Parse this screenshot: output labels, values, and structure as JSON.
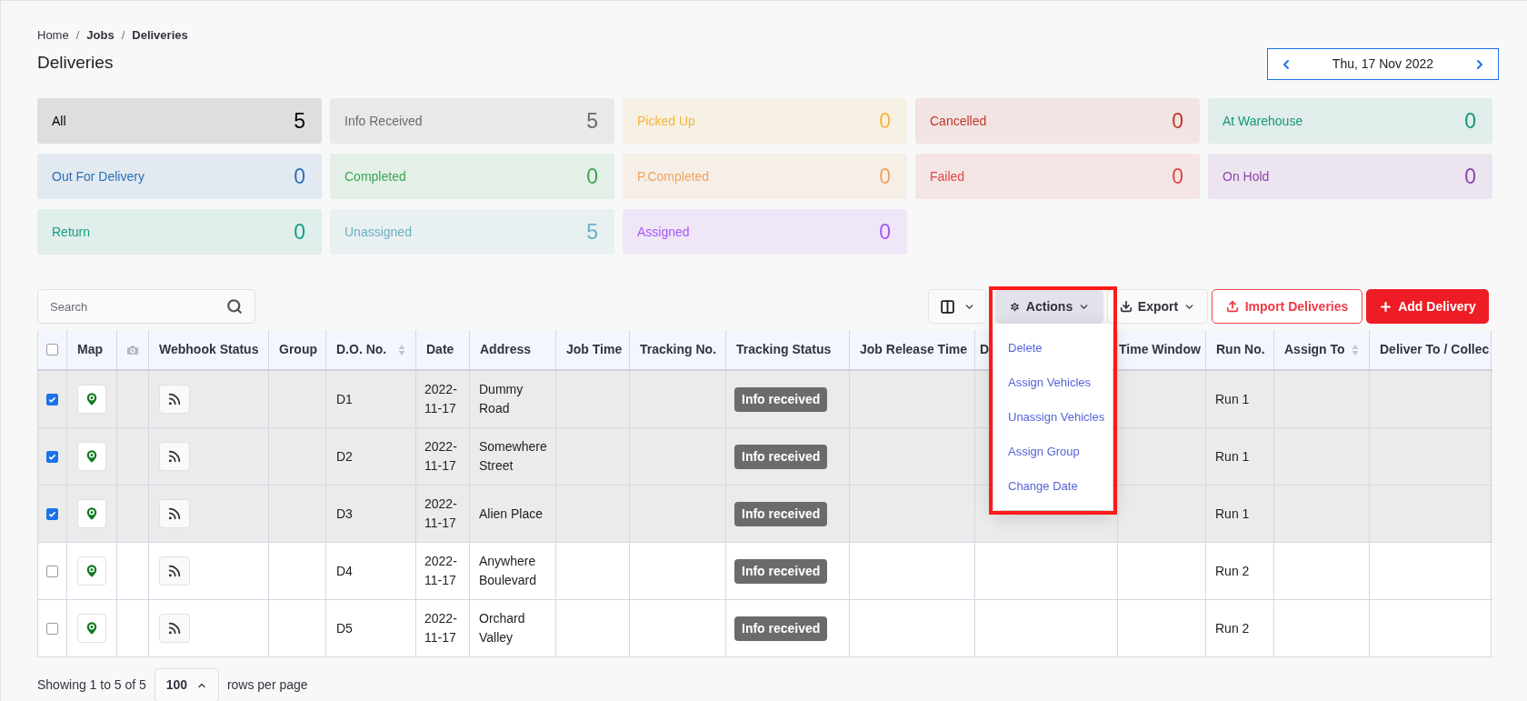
{
  "breadcrumb": {
    "separator": "/",
    "items": [
      {
        "label": "Home",
        "bold": false
      },
      {
        "label": "Jobs",
        "bold": true
      },
      {
        "label": "Deliveries",
        "bold": true
      }
    ]
  },
  "title": "Deliveries",
  "date_picker": {
    "value": "Thu, 17 Nov 2022"
  },
  "status_cards": [
    {
      "label": "All",
      "count": "5",
      "color": "#000000"
    },
    {
      "label": "Info Received",
      "count": "5",
      "color": "#6b6b6b"
    },
    {
      "label": "Picked Up",
      "count": "0",
      "color": "#f5b53b"
    },
    {
      "label": "Cancelled",
      "count": "0",
      "color": "#c0392b"
    },
    {
      "label": "At Warehouse",
      "count": "0",
      "color": "#14967a"
    },
    {
      "label": "Out For Delivery",
      "count": "0",
      "color": "#2b6fb5"
    },
    {
      "label": "Completed",
      "count": "0",
      "color": "#3aa655"
    },
    {
      "label": "P.Completed",
      "count": "0",
      "color": "#f0a35e"
    },
    {
      "label": "Failed",
      "count": "0",
      "color": "#e04848"
    },
    {
      "label": "On Hold",
      "count": "0",
      "color": "#8e44ad"
    },
    {
      "label": "Return",
      "count": "0",
      "color": "#16a085"
    },
    {
      "label": "Unassigned",
      "count": "5",
      "color": "#6bb0c6"
    },
    {
      "label": "Assigned",
      "count": "0",
      "color": "#a855f7"
    }
  ],
  "search": {
    "placeholder": "Search"
  },
  "toolbar": {
    "actions": {
      "label": "Actions",
      "expanded": true,
      "items": [
        "Delete",
        "Assign Vehicles",
        "Unassign Vehicles",
        "Assign Group",
        "Change Date"
      ]
    },
    "export": {
      "label": "Export"
    },
    "import": {
      "label": "Import Deliveries"
    },
    "add": {
      "label": "Add Delivery"
    }
  },
  "table": {
    "columns": [
      {
        "kind": "checkbox",
        "checked": false
      },
      {
        "kind": "text",
        "label": "Map"
      },
      {
        "kind": "icon"
      },
      {
        "kind": "text",
        "label": "Webhook Status"
      },
      {
        "kind": "text",
        "label": "Group"
      },
      {
        "kind": "text",
        "label": "D.O. No.",
        "sortable": true
      },
      {
        "kind": "text",
        "label": "Date"
      },
      {
        "kind": "text",
        "label": "Address"
      },
      {
        "kind": "text",
        "label": "Job Time"
      },
      {
        "kind": "text",
        "label": "Tracking No."
      },
      {
        "kind": "text",
        "label": "Tracking Status"
      },
      {
        "kind": "text",
        "label": "Job Release Time"
      },
      {
        "kind": "text",
        "label": "D"
      },
      {
        "kind": "text",
        "label": "Time Window"
      },
      {
        "kind": "text",
        "label": "Run No."
      },
      {
        "kind": "text",
        "label": "Assign To",
        "sortable": true
      },
      {
        "kind": "text",
        "label": "Deliver To / Collec"
      }
    ],
    "rows": [
      {
        "selected": true,
        "do_no": "D1",
        "date": "2022-11-17",
        "address": "Dummy Road",
        "tracking_status": "Info received",
        "run_no": "Run 1"
      },
      {
        "selected": true,
        "do_no": "D2",
        "date": "2022-11-17",
        "address": "Somewhere Street",
        "tracking_status": "Info received",
        "run_no": "Run 1"
      },
      {
        "selected": true,
        "do_no": "D3",
        "date": "2022-11-17",
        "address": "Alien Place",
        "tracking_status": "Info received",
        "run_no": "Run 1"
      },
      {
        "selected": false,
        "do_no": "D4",
        "date": "2022-11-17",
        "address": "Anywhere Boulevard",
        "tracking_status": "Info received",
        "run_no": "Run 2"
      },
      {
        "selected": false,
        "do_no": "D5",
        "date": "2022-11-17",
        "address": "Orchard Valley",
        "tracking_status": "Info received",
        "run_no": "Run 2"
      }
    ]
  },
  "footer": {
    "summary": "Showing 1 to 5 of 5",
    "page_size": "100",
    "suffix": "rows per page"
  }
}
